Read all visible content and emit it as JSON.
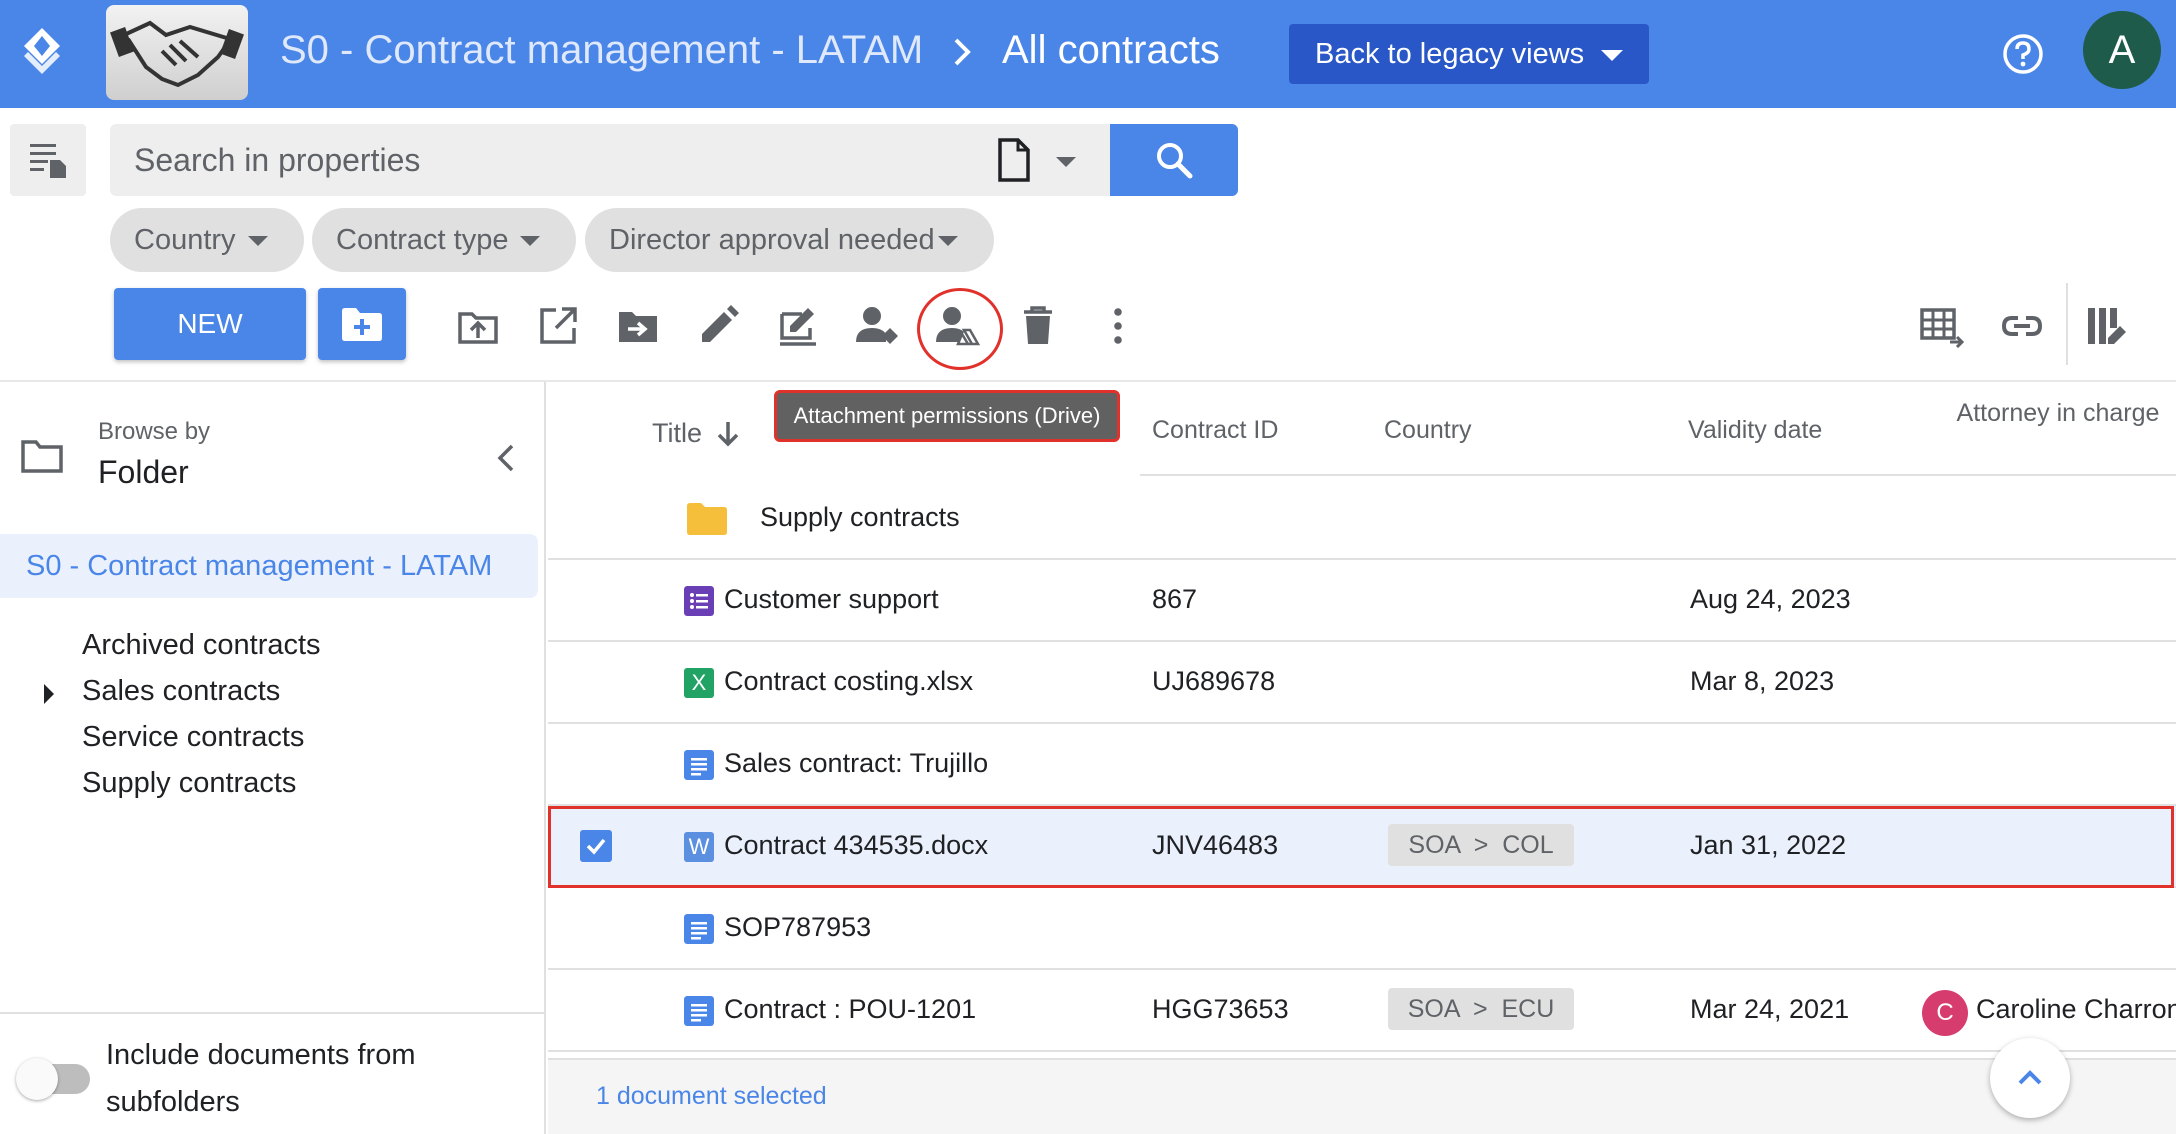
{
  "header": {
    "breadcrumb_root": "S0 - Contract management - LATAM",
    "breadcrumb_current": "All contracts",
    "legacy_button": "Back to legacy views",
    "avatar_letter": "A",
    "brand_color": "#4a86e8"
  },
  "search": {
    "placeholder": "Search in properties",
    "value": ""
  },
  "filters": [
    "Country",
    "Contract type",
    "Director approval needed"
  ],
  "toolbar": {
    "new_label": "NEW",
    "icons": [
      "new-folder-icon",
      "upload-icon",
      "open-in-new-icon",
      "move-to-folder-icon",
      "edit-icon",
      "sign-icon",
      "permissions-icon",
      "attachment-permissions-drive-icon",
      "delete-icon",
      "more-vert-icon",
      "table-export-icon",
      "link-icon",
      "column-settings-icon"
    ],
    "tooltip": "Attachment permissions (Drive)"
  },
  "sidebar": {
    "browse_label": "Browse by",
    "browse_value": "Folder",
    "root": "S0 - Contract management - LATAM",
    "items": [
      "Archived contracts",
      "Sales contracts",
      "Service contracts",
      "Supply contracts"
    ],
    "include_subfolders_label": "Include documents from subfolders",
    "include_subfolders_enabled": false
  },
  "table": {
    "columns": {
      "title": "Title",
      "contract_id": "Contract ID",
      "country": "Country",
      "validity_date": "Validity date",
      "attorney": "Attorney in charge"
    },
    "rows": [
      {
        "type": "folder",
        "title": "Supply contracts",
        "contract_id": "",
        "country": "",
        "validity_date": "",
        "attorney": ""
      },
      {
        "type": "form",
        "icon_letter": "",
        "title": "Customer support",
        "contract_id": "867",
        "country": "",
        "validity_date": "Aug 24, 2023",
        "attorney": ""
      },
      {
        "type": "sheet",
        "icon_letter": "X",
        "title": "Contract costing.xlsx",
        "contract_id": "UJ689678",
        "country": "",
        "validity_date": "Mar 8, 2023",
        "attorney": ""
      },
      {
        "type": "doc",
        "icon_letter": "",
        "title": "Sales contract: Trujillo",
        "contract_id": "",
        "country": "",
        "validity_date": "",
        "attorney": ""
      },
      {
        "type": "word",
        "icon_letter": "W",
        "title": "Contract 434535.docx",
        "contract_id": "JNV46483",
        "country": "SOA  >  COL",
        "validity_date": "Jan 31, 2022",
        "attorney": "",
        "selected": true
      },
      {
        "type": "doc",
        "icon_letter": "",
        "title": "SOP787953",
        "contract_id": "",
        "country": "",
        "validity_date": "",
        "attorney": ""
      },
      {
        "type": "doc",
        "icon_letter": "",
        "title": "Contract : POU-1201",
        "contract_id": "HGG73653",
        "country": "SOA  >  ECU",
        "validity_date": "Mar 24, 2021",
        "attorney": "Caroline Charron",
        "attorney_initial": "C"
      }
    ],
    "selection_status": "1 document selected"
  }
}
